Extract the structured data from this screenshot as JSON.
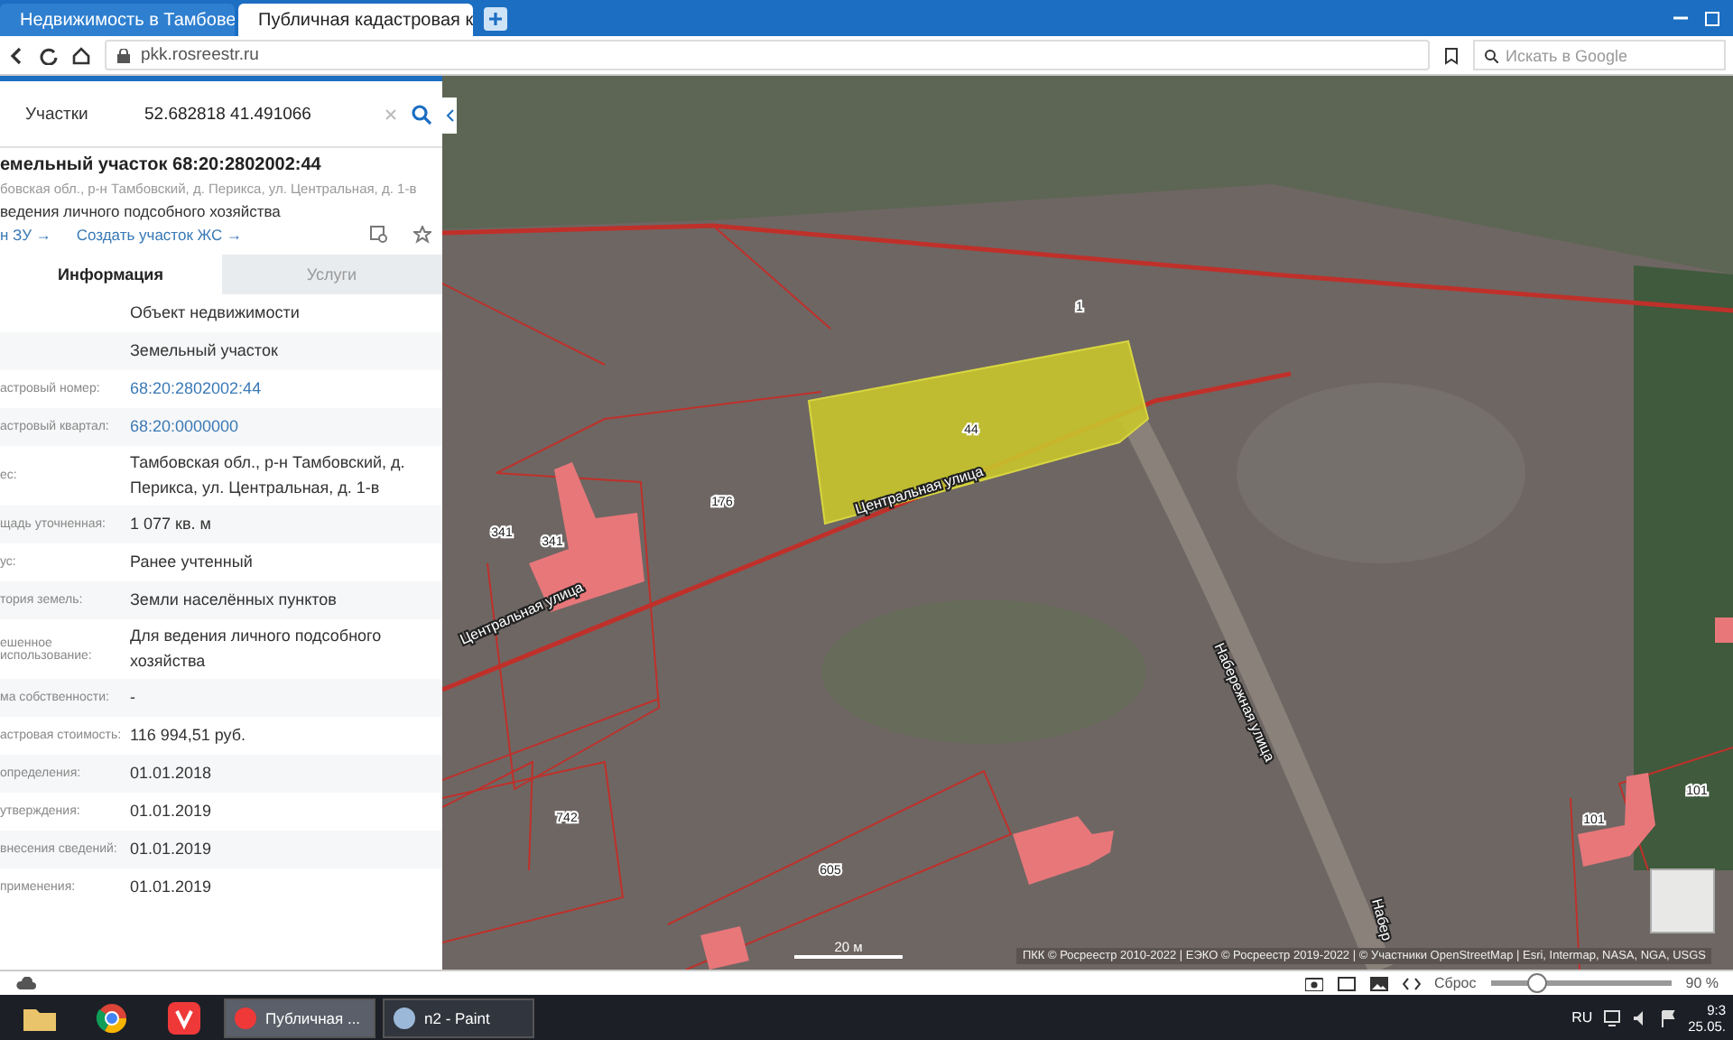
{
  "browser": {
    "tabs": [
      {
        "title": "Недвижимость в Тамбове",
        "selected": false
      },
      {
        "title": "Публичная кадастровая к",
        "selected": true
      }
    ],
    "url": "pkk.rosreestr.ru",
    "search_placeholder": "Искать в Google"
  },
  "search": {
    "category": "Участки",
    "value": "52.682818 41.491066"
  },
  "card": {
    "title": "емельный участок 68:20:2802002:44",
    "address": "бовская обл., р-н Тамбовский, д. Перикса, ул. Центральная, д. 1-в",
    "purpose": "ведения личного подсобного хозяйства",
    "links": [
      "н ЗУ →",
      "Создать участок ЖС →"
    ]
  },
  "panel_tabs": [
    {
      "label": "Информация",
      "selected": true
    },
    {
      "label": "Услуги",
      "selected": false
    }
  ],
  "rows": [
    {
      "value": "Объект недвижимости",
      "kind": "text"
    },
    {
      "value": "Земельный участок",
      "kind": "text"
    },
    {
      "label": "астровый номер:",
      "value": "68:20:2802002:44",
      "kind": "link"
    },
    {
      "label": "астровый квартал:",
      "value": "68:20:0000000",
      "kind": "link"
    },
    {
      "label": "ес:",
      "value": "Тамбовская обл., р-н Тамбовский, д. Перикса, ул. Центральная, д. 1-в",
      "kind": "text"
    },
    {
      "label": "щадь уточненная:",
      "value": "1 077 кв. м",
      "kind": "text"
    },
    {
      "label": "ус:",
      "value": "Ранее учтенный",
      "kind": "text"
    },
    {
      "label": "тория земель:",
      "value": "Земли населённых пунктов",
      "kind": "text"
    },
    {
      "label": "ешенное использование:",
      "value": "Для ведения личного подсобного хозяйства",
      "kind": "text"
    },
    {
      "label": "ма собственности:",
      "value": "-",
      "kind": "text"
    },
    {
      "label": "астровая стоимость:",
      "value": "116 994,51 руб.",
      "kind": "text"
    },
    {
      "label": "определения:",
      "value": "01.01.2018",
      "kind": "text"
    },
    {
      "label": "утверждения:",
      "value": "01.01.2019",
      "kind": "text"
    },
    {
      "label": "внесения сведений:",
      "value": "01.01.2019",
      "kind": "text"
    },
    {
      "label": "применения:",
      "value": "01.01.2019",
      "kind": "text"
    }
  ],
  "map": {
    "labels": [
      {
        "text": "1",
        "kind": "number"
      },
      {
        "text": "44",
        "kind": "number"
      },
      {
        "text": "176",
        "kind": "number"
      },
      {
        "text": "341",
        "kind": "number"
      },
      {
        "text": "341",
        "kind": "number"
      },
      {
        "text": "Центральная улица",
        "kind": "street"
      },
      {
        "text": "Центральная улица",
        "kind": "street"
      },
      {
        "text": "Набережная улица",
        "kind": "street"
      },
      {
        "text": "Набер",
        "kind": "street"
      },
      {
        "text": "742",
        "kind": "number"
      },
      {
        "text": "605",
        "kind": "number"
      },
      {
        "text": "101",
        "kind": "number"
      },
      {
        "text": "101",
        "kind": "number"
      }
    ],
    "scale": "20 м",
    "attribution": "ПКК © Росреестр 2010-2022 | ЕЭКО © Росреестр 2019-2022 | © Участники OpenStreetMap | Esri, Intermap, NASA, NGA, USGS"
  },
  "status": {
    "reset": "Сброс",
    "zoom": {
      "level": 0.25
    },
    "zoom_text": "90 %"
  },
  "taskbar": {
    "windows": [
      {
        "title": "Публичная ...",
        "selected": true
      },
      {
        "title": "n2 - Paint",
        "selected": false
      }
    ],
    "lang": "RU",
    "time": "9:3",
    "date": "25.05."
  }
}
